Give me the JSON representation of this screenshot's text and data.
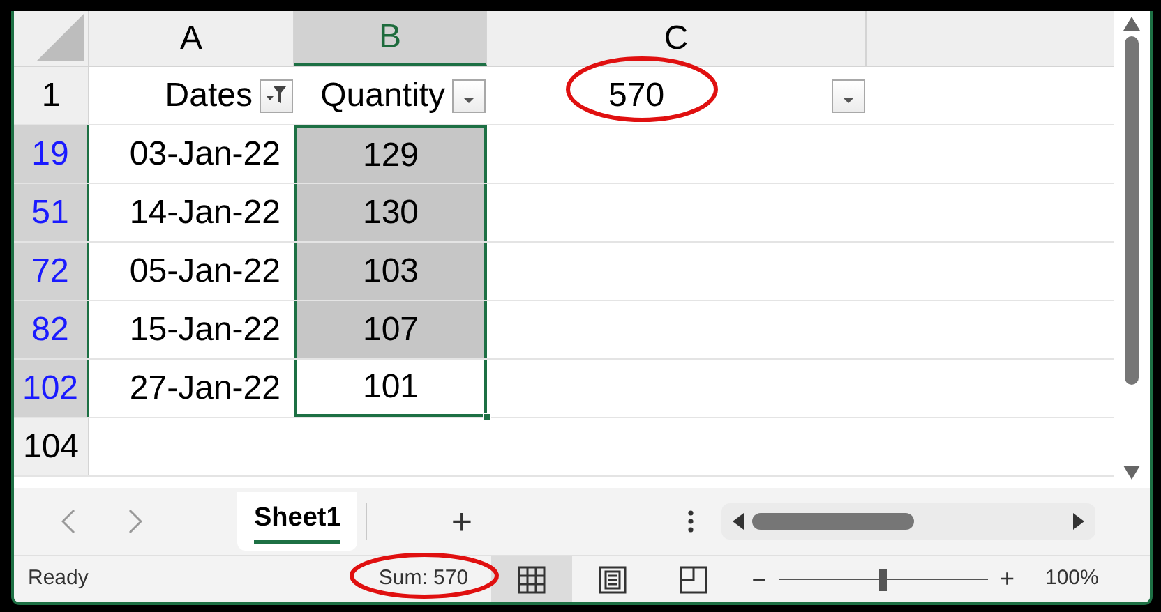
{
  "column_headers": [
    {
      "label": "A",
      "selected": false
    },
    {
      "label": "B",
      "selected": true
    },
    {
      "label": "C",
      "selected": false
    }
  ],
  "header_row": {
    "number": "1",
    "cells": [
      {
        "text": "Dates",
        "filter_active": true
      },
      {
        "text": "Quantity",
        "filter_active": false
      },
      {
        "text": "570",
        "filter_active": false,
        "circled": true
      }
    ]
  },
  "rows": [
    {
      "number": "19",
      "filtered": true,
      "selected": true,
      "date": "03-Jan-22",
      "quantity": "129",
      "highlighted": true
    },
    {
      "number": "51",
      "filtered": true,
      "selected": true,
      "date": "14-Jan-22",
      "quantity": "130",
      "highlighted": true
    },
    {
      "number": "72",
      "filtered": true,
      "selected": true,
      "date": "05-Jan-22",
      "quantity": "103",
      "highlighted": true
    },
    {
      "number": "82",
      "filtered": true,
      "selected": true,
      "date": "15-Jan-22",
      "quantity": "107",
      "highlighted": true
    },
    {
      "number": "102",
      "filtered": true,
      "selected": true,
      "date": "27-Jan-22",
      "quantity": "101",
      "highlighted": false
    },
    {
      "number": "104",
      "filtered": false,
      "selected": false
    }
  ],
  "sheet_tabs": [
    {
      "label": "Sheet1",
      "selected": true
    }
  ],
  "add_sheet": "+",
  "status_bar": {
    "status": "Ready",
    "sum": "Sum: 570",
    "sum_circled": true,
    "views": [
      {
        "kind": "normal",
        "selected": true
      },
      {
        "kind": "page-layout",
        "selected": false
      },
      {
        "kind": "page-break",
        "selected": false
      }
    ],
    "zoom_minus": "–",
    "zoom_plus": "+",
    "zoom": {
      "level": 0.5
    },
    "zoom_reading": "100%"
  }
}
